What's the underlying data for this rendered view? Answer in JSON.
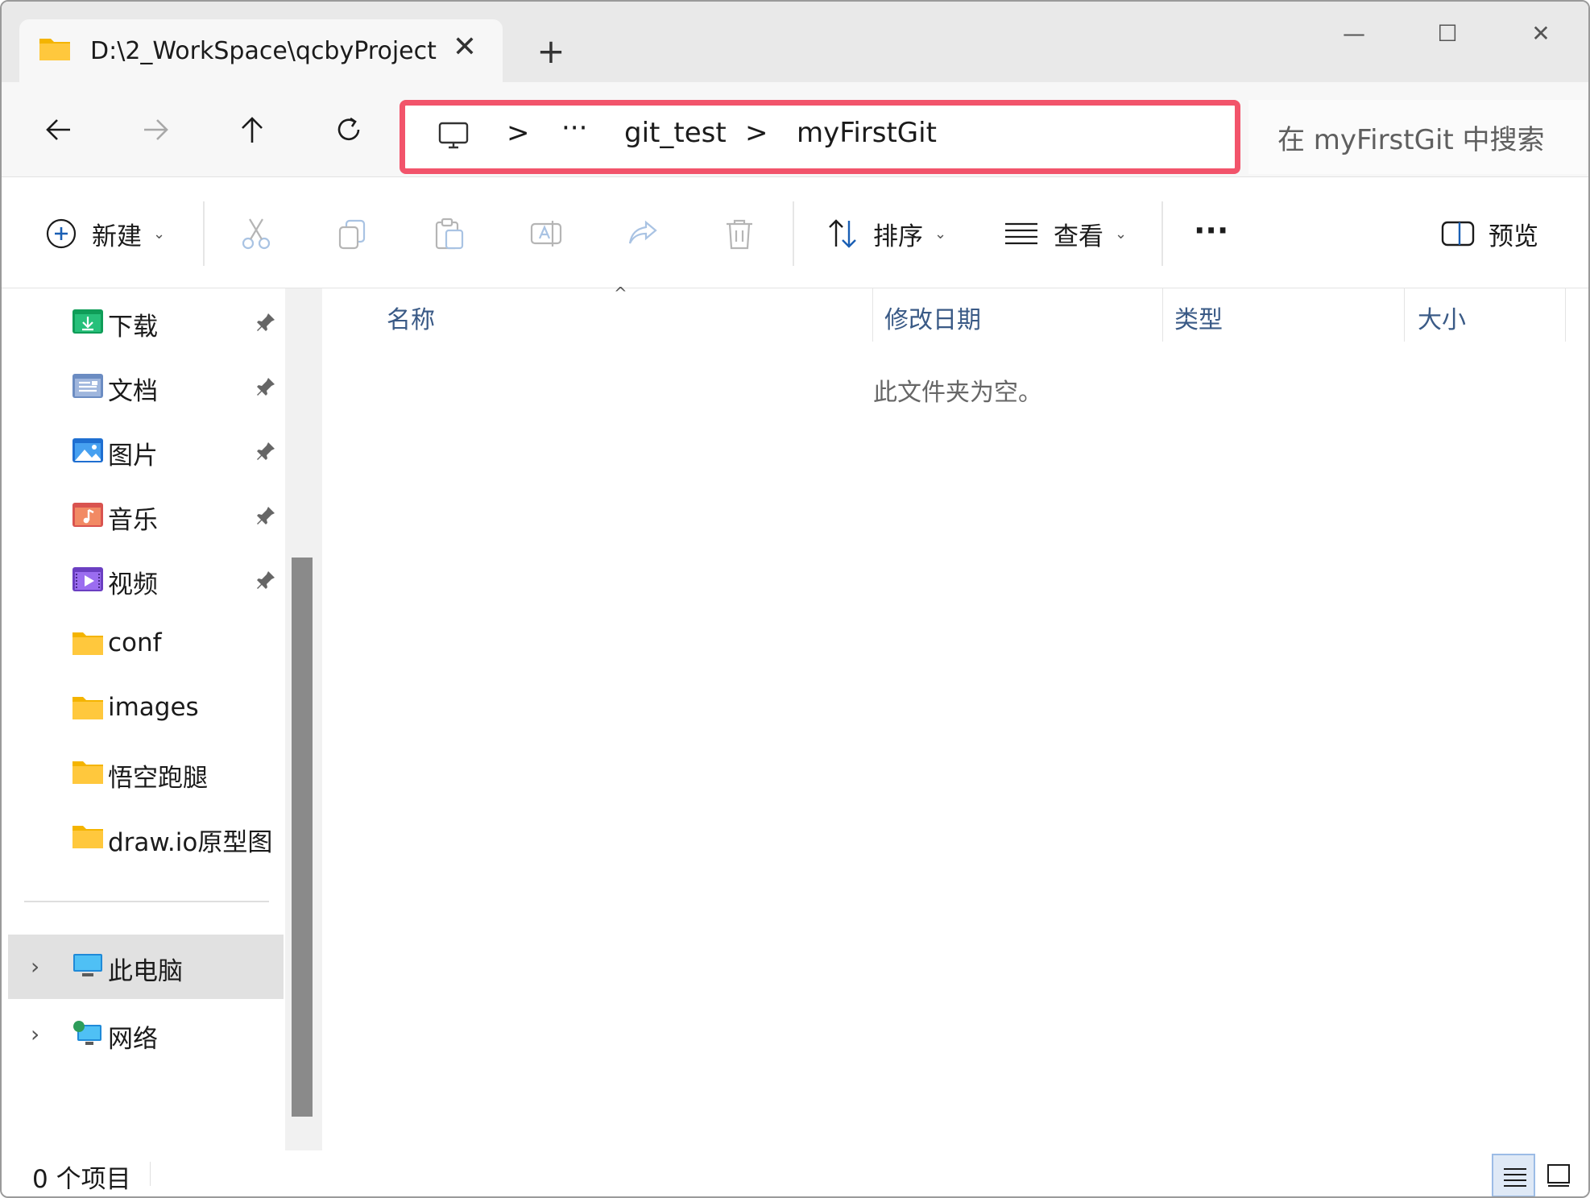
{
  "tab": {
    "title": "D:\\2_WorkSpace\\qcbyProject\\"
  },
  "breadcrumb": {
    "ellipsis": "···",
    "items": [
      "git_test",
      "myFirstGit"
    ],
    "separator": ">"
  },
  "search": {
    "placeholder": "在 myFirstGit 中搜索"
  },
  "toolbar": {
    "new_label": "新建",
    "sort_label": "排序",
    "view_label": "查看",
    "more_label": "···",
    "preview_label": "预览"
  },
  "sidebar": {
    "items": [
      {
        "label": "下载",
        "icon": "downloads-folder-icon",
        "pinned": true
      },
      {
        "label": "文档",
        "icon": "documents-folder-icon",
        "pinned": true
      },
      {
        "label": "图片",
        "icon": "pictures-folder-icon",
        "pinned": true
      },
      {
        "label": "音乐",
        "icon": "music-folder-icon",
        "pinned": true
      },
      {
        "label": "视频",
        "icon": "videos-folder-icon",
        "pinned": true
      },
      {
        "label": "conf",
        "icon": "folder-icon",
        "pinned": false
      },
      {
        "label": "images",
        "icon": "folder-icon",
        "pinned": false
      },
      {
        "label": "悟空跑腿",
        "icon": "folder-icon",
        "pinned": false
      },
      {
        "label": "draw.io原型图",
        "icon": "folder-icon",
        "pinned": false
      }
    ],
    "this_pc": "此电脑",
    "network": "网络"
  },
  "columns": {
    "name": "名称",
    "modified": "修改日期",
    "type": "类型",
    "size": "大小"
  },
  "content": {
    "empty_message": "此文件夹为空。"
  },
  "status": {
    "item_count": "0 个项目"
  },
  "colors": {
    "highlight_border": "#f2546b",
    "folder_yellow": "#ffc83d",
    "column_text": "#3a5a86"
  }
}
